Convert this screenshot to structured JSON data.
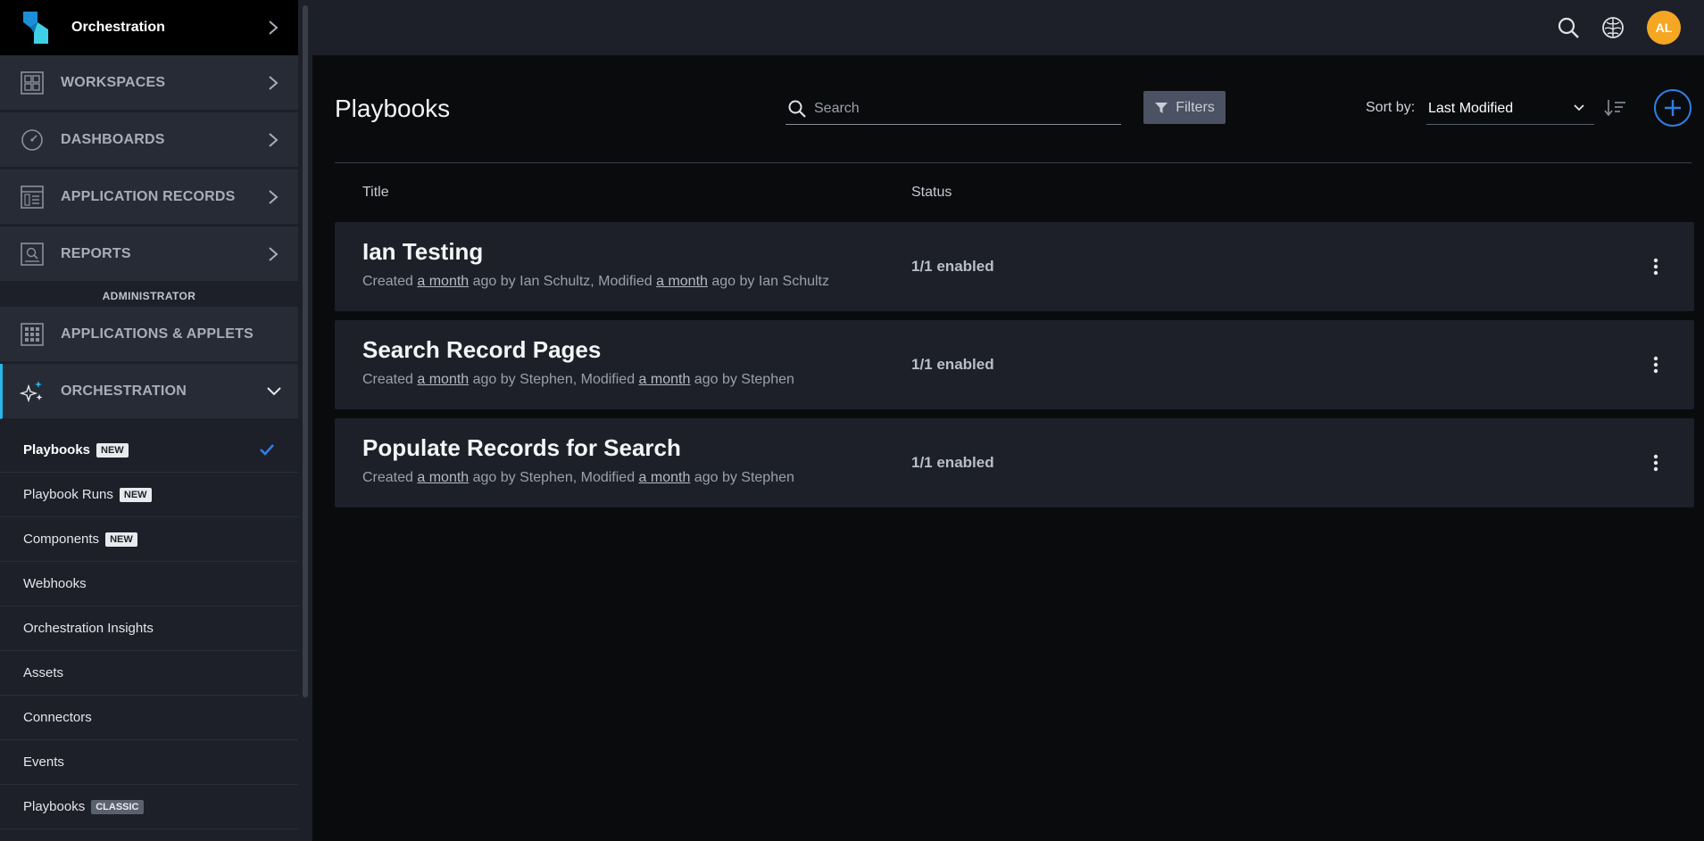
{
  "brand": {
    "name": "Orchestration"
  },
  "nav": {
    "items": [
      {
        "label": "WORKSPACES",
        "icon": "workspaces-icon"
      },
      {
        "label": "DASHBOARDS",
        "icon": "dashboard-gauge-icon"
      },
      {
        "label": "APPLICATION RECORDS",
        "icon": "records-icon"
      },
      {
        "label": "REPORTS",
        "icon": "reports-icon"
      }
    ],
    "admin_header": "ADMINISTRATOR",
    "admin_items": [
      {
        "label": "APPLICATIONS & APPLETS",
        "icon": "applications-grid-icon"
      },
      {
        "label": "ORCHESTRATION",
        "icon": "sparkle-icon"
      }
    ],
    "sub_items": [
      {
        "label": "Playbooks",
        "badge": "NEW",
        "selected": true
      },
      {
        "label": "Playbook Runs",
        "badge": "NEW"
      },
      {
        "label": "Components",
        "badge": "NEW"
      },
      {
        "label": "Webhooks"
      },
      {
        "label": "Orchestration Insights"
      },
      {
        "label": "Assets"
      },
      {
        "label": "Connectors"
      },
      {
        "label": "Events"
      },
      {
        "label": "Playbooks",
        "badge": "CLASSIC"
      }
    ]
  },
  "topbar": {
    "avatar_initials": "AL",
    "accent": "#f5a623"
  },
  "page": {
    "title": "Playbooks",
    "search_placeholder": "Search",
    "filters_label": "Filters",
    "sort_label": "Sort by:",
    "sort_value": "Last Modified"
  },
  "table": {
    "columns": [
      "Title",
      "Status"
    ],
    "rows": [
      {
        "title": "Ian Testing",
        "meta_created": "Created ",
        "meta_created_when": "a month",
        "meta_created_by": " ago by Ian Schultz, Modified ",
        "meta_modified_when": "a month",
        "meta_modified_by": " ago by Ian Schultz",
        "status": "1/1 enabled"
      },
      {
        "title": "Search Record Pages",
        "meta_created": "Created ",
        "meta_created_when": "a month",
        "meta_created_by": " ago by Stephen, Modified ",
        "meta_modified_when": "a month",
        "meta_modified_by": " ago by Stephen",
        "status": "1/1 enabled"
      },
      {
        "title": "Populate Records for Search",
        "meta_created": "Created ",
        "meta_created_when": "a month",
        "meta_created_by": " ago by Stephen, Modified ",
        "meta_modified_when": "a month",
        "meta_modified_by": " ago by Stephen",
        "status": "1/1 enabled"
      }
    ]
  }
}
